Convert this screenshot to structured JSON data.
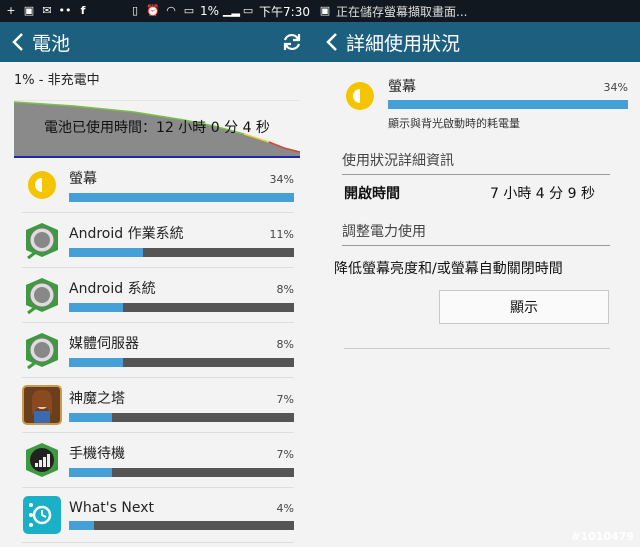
{
  "left": {
    "statusbar": {
      "battery_percent": "1%",
      "time": "下午7:30"
    },
    "title": "電池",
    "charge_status": "1% - 非充電中",
    "chart_label": "電池已使用時間：12 小時 0 分 4 秒",
    "usage": [
      {
        "name": "螢幕",
        "percent": "34%",
        "fraction": 1.0,
        "icon": "screen-brightness-icon"
      },
      {
        "name": "Android 作業系統",
        "percent": "11%",
        "fraction": 0.33,
        "icon": "android-os-icon"
      },
      {
        "name": "Android 系統",
        "percent": "8%",
        "fraction": 0.24,
        "icon": "android-system-icon"
      },
      {
        "name": "媒體伺服器",
        "percent": "8%",
        "fraction": 0.24,
        "icon": "media-server-icon"
      },
      {
        "name": "神魔之塔",
        "percent": "7%",
        "fraction": 0.19,
        "icon": "tower-of-saviors-icon"
      },
      {
        "name": "手機待機",
        "percent": "7%",
        "fraction": 0.19,
        "icon": "phone-standby-icon"
      },
      {
        "name": "What's Next",
        "percent": "4%",
        "fraction": 0.11,
        "icon": "whats-next-icon"
      }
    ]
  },
  "right": {
    "notification": "正在儲存螢幕擷取畫面...",
    "title": "詳細使用狀況",
    "app": {
      "name": "螢幕",
      "percent": "34%",
      "desc": "顯示與背光啟動時的耗電量"
    },
    "usage_details_header": "使用狀況詳細資訊",
    "on_time_label": "開啟時間",
    "on_time_value": "7 小時 4 分 9 秒",
    "adjust_header": "調整電力使用",
    "adjust_desc": "降低螢幕亮度和/或螢幕自動關閉時間",
    "show_button": "顯示"
  },
  "watermark": "#1010479",
  "colors": {
    "actionbar": "#1d5f7f",
    "bar_fill": "#46a0d8",
    "bar_bg": "#555555",
    "statusbar": "#11181f"
  }
}
